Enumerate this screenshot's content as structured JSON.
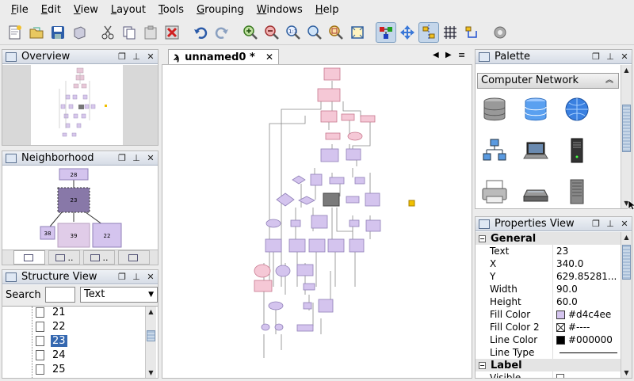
{
  "menu": [
    {
      "pre": "",
      "ul": "F",
      "post": "ile"
    },
    {
      "pre": "",
      "ul": "E",
      "post": "dit"
    },
    {
      "pre": "",
      "ul": "V",
      "post": "iew"
    },
    {
      "pre": "",
      "ul": "L",
      "post": "ayout"
    },
    {
      "pre": "",
      "ul": "T",
      "post": "ools"
    },
    {
      "pre": "",
      "ul": "G",
      "post": "rouping"
    },
    {
      "pre": "",
      "ul": "W",
      "post": "indows"
    },
    {
      "pre": "",
      "ul": "H",
      "post": "elp"
    }
  ],
  "overview": {
    "title": "Overview"
  },
  "neighborhood": {
    "title": "Neighborhood",
    "nodes": {
      "top": "28",
      "center": "23",
      "left": "38",
      "mid": "39",
      "right": "22"
    },
    "tabs": [
      "",
      "..",
      "..",
      ""
    ]
  },
  "structure": {
    "title": "Structure View",
    "search_label": "Search",
    "search_value": "",
    "filter_value": "Text",
    "items": [
      "21",
      "22",
      "23",
      "24",
      "25"
    ],
    "selected": "23"
  },
  "editor": {
    "tab_label": "unnamed0 *"
  },
  "palette": {
    "title": "Palette",
    "category": "Computer Network",
    "icons": [
      "database-icon",
      "database-stack-icon",
      "globe-icon",
      "network-icon",
      "laptop-icon",
      "server-tower-icon",
      "printer-icon",
      "scanner-icon",
      "server-rack-icon"
    ]
  },
  "properties": {
    "title": "Properties View",
    "general_label": "General",
    "label_label": "Label",
    "rows": [
      {
        "key": "Text",
        "value": "23"
      },
      {
        "key": "X",
        "value": "340.0"
      },
      {
        "key": "Y",
        "value": "629.85281..."
      },
      {
        "key": "Width",
        "value": "90.0"
      },
      {
        "key": "Height",
        "value": "60.0"
      },
      {
        "key": "Fill Color",
        "value": "#d4c4ee",
        "swatch": "#d4c4ee"
      },
      {
        "key": "Fill Color 2",
        "value": "#----",
        "swatch": "none"
      },
      {
        "key": "Line Color",
        "value": "#000000",
        "swatch": "#000000"
      },
      {
        "key": "Line Type",
        "value": ""
      }
    ],
    "visible_label": "Visible"
  },
  "colors": {
    "pink": "#f5c8d6",
    "pinkBorder": "#c8788e",
    "lavender": "#d4c4ee",
    "lavBorder": "#9080b8",
    "gray": "#808080",
    "accent": "#3568b0",
    "yellow": "#f0c000"
  }
}
